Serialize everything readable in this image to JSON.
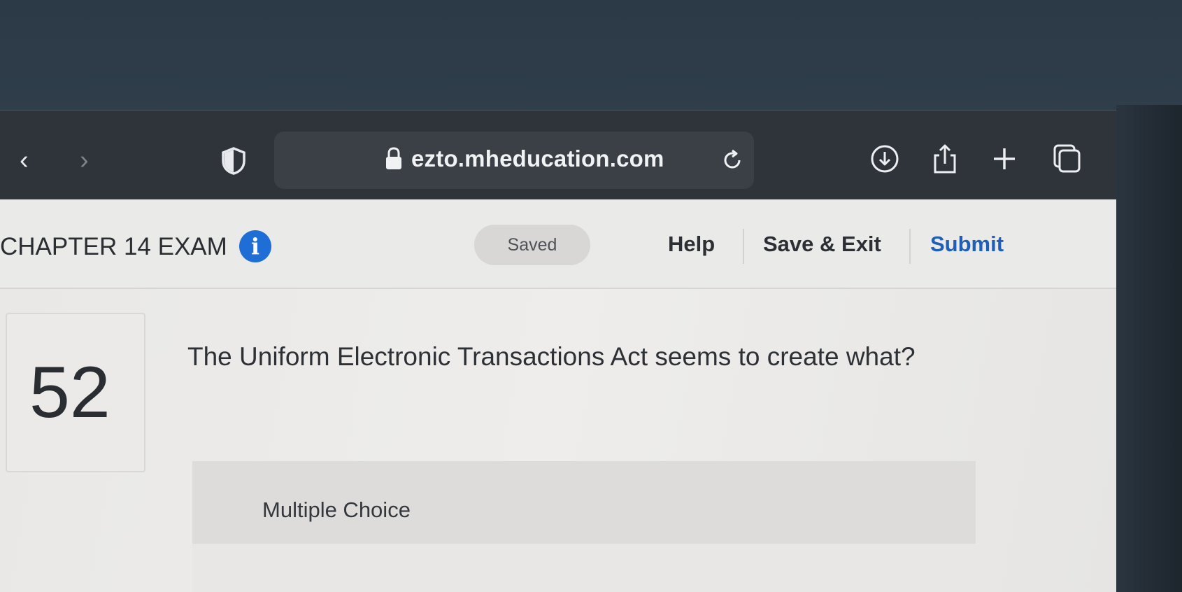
{
  "browser": {
    "url": "ezto.mheducation.com",
    "back_glyph": "‹",
    "forward_glyph": "›",
    "icons": [
      "chevron-left-icon",
      "chevron-right-icon",
      "shield-icon",
      "lock-icon",
      "reload-icon",
      "download-icon",
      "share-icon",
      "plus-icon",
      "tabs-icon"
    ]
  },
  "header": {
    "title": "CHAPTER 14 EXAM",
    "info_glyph": "i",
    "status": "Saved",
    "help_label": "Help",
    "save_exit_label": "Save & Exit",
    "submit_label": "Submit"
  },
  "question": {
    "number": "52",
    "text": "The Uniform Electronic Transactions Act seems to create what?",
    "type_label": "Multiple Choice"
  },
  "colors": {
    "accent": "#1f5fb8",
    "info_icon": "#1e6ed6",
    "toolbar": "#2f343b"
  }
}
